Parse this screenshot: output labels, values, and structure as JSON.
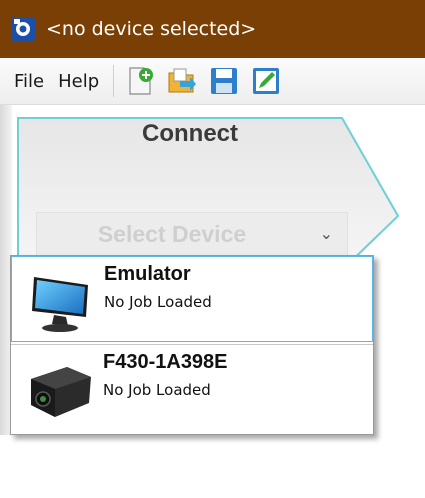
{
  "window": {
    "title": "<no device selected>",
    "icon": "app-logo-icon",
    "titlebar_color": "#7a3f05"
  },
  "menu": {
    "file_label": "File",
    "help_label": "Help"
  },
  "toolbar": {
    "buttons": [
      "new-job-icon",
      "open-job-icon",
      "save-job-icon",
      "edit-job-icon"
    ]
  },
  "connect_panel": {
    "title": "Connect",
    "select_device_label": "Select Device",
    "chevron": "chevron-down-icon"
  },
  "device_list": {
    "items": [
      {
        "name": "Emulator",
        "status": "No Job Loaded",
        "icon": "monitor-icon",
        "selected": true
      },
      {
        "name": "F430-1A398E",
        "status": "No Job Loaded",
        "icon": "camera-device-icon",
        "selected": false
      }
    ],
    "selection_color": "#5fb6e6"
  }
}
